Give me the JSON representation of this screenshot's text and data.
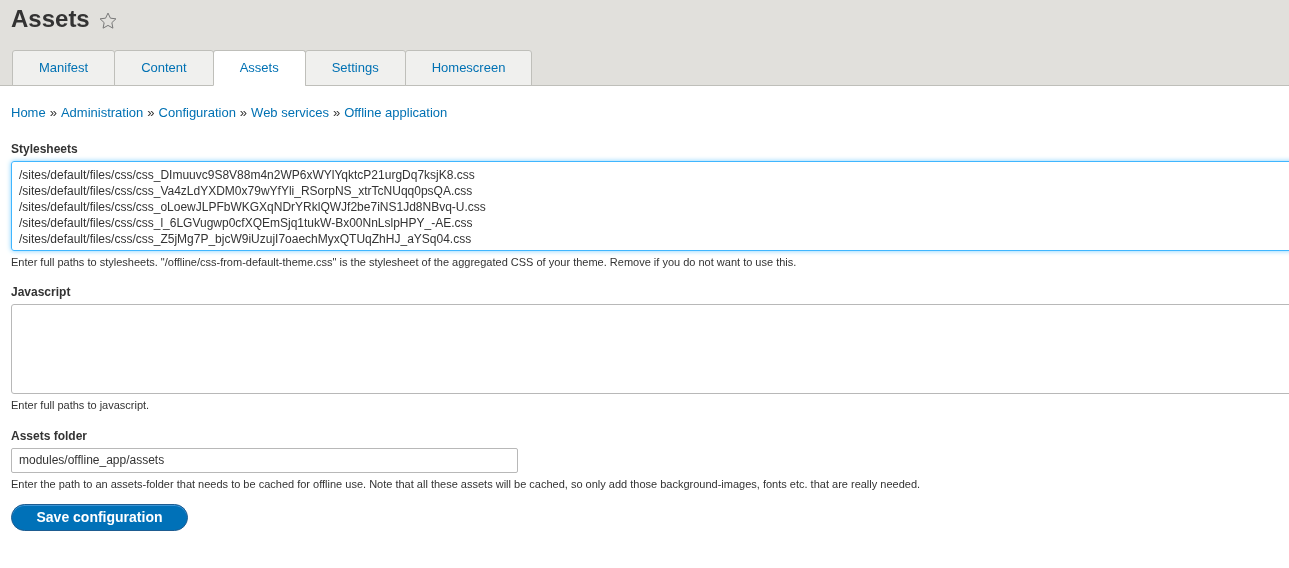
{
  "page_title": "Assets",
  "favorite": {
    "starred": false
  },
  "tabs": [
    {
      "label": "Manifest",
      "selected": false
    },
    {
      "label": "Content",
      "selected": false
    },
    {
      "label": "Assets",
      "selected": true
    },
    {
      "label": "Settings",
      "selected": false
    },
    {
      "label": "Homescreen",
      "selected": false
    }
  ],
  "breadcrumb": [
    "Home",
    "Administration",
    "Configuration",
    "Web services",
    "Offline application"
  ],
  "breadcrumb_separator": "»",
  "fields": [
    {
      "kind": "textarea",
      "label": "Stylesheets",
      "focused": true,
      "value": [
        "/sites/default/files/css/css_DImuuvc9S8V88m4n2WP6xWYlYqktcP21urgDq7ksjK8.css",
        "/sites/default/files/css/css_Va4zLdYXDM0x79wYfYli_RSorpNS_xtrTcNUqq0psQA.css",
        "/sites/default/files/css/css_oLoewJLPFbWKGXqNDrYRklQWJf2be7iNS1Jd8NBvq-U.css",
        "/sites/default/files/css/css_l_6LGVugwp0cfXQEmSjq1tukW-Bx00NnLslpHPY_-AE.css",
        "/sites/default/files/css/css_Z5jMg7P_bjcW9iUzujI7oaechMyxQTUqZhHJ_aYSq04.css"
      ],
      "description": "Enter full paths to stylesheets. \"/offline/css-from-default-theme.css\" is the stylesheet of the aggregated CSS of your theme. Remove if you do not want to use this."
    },
    {
      "kind": "textarea",
      "label": "Javascript",
      "focused": false,
      "description": "Enter full paths to javascript."
    },
    {
      "kind": "text",
      "label": "Assets folder",
      "focused": false,
      "value": [
        "modules/offline_app/assets"
      ],
      "description": "Enter the path to an assets-folder that needs to be cached for offline use. Note that all these assets will be cached, so only add those background-images, fonts etc. that are really needed."
    }
  ],
  "submit_button": "Save configuration"
}
